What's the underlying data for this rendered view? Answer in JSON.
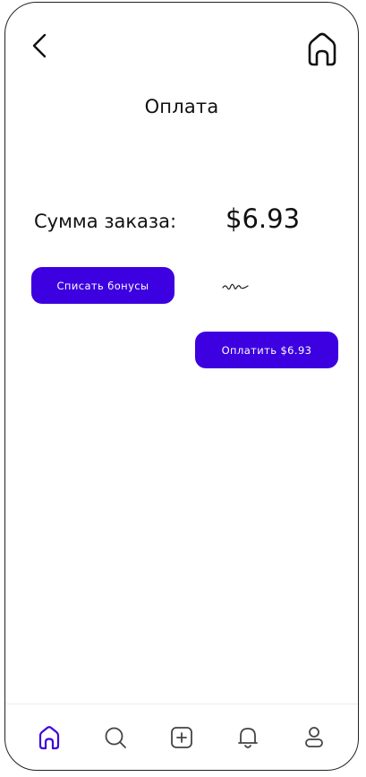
{
  "header": {
    "title": "Оплата",
    "back_icon": "chevron-left-icon",
    "home_icon": "home-icon"
  },
  "order": {
    "label": "Сумма заказа:",
    "amount": "$6.93"
  },
  "bonus": {
    "button_label": "Списать бонусы"
  },
  "payment": {
    "button_label": "Оплатить $6.93"
  },
  "bottom_nav": {
    "items": [
      {
        "icon": "home-icon",
        "active": true
      },
      {
        "icon": "search-icon",
        "active": false
      },
      {
        "icon": "add-icon",
        "active": false
      },
      {
        "icon": "bell-icon",
        "active": false
      },
      {
        "icon": "profile-icon",
        "active": false
      }
    ]
  },
  "colors": {
    "accent": "#3d00e0",
    "text": "#111111",
    "background": "#ffffff"
  }
}
